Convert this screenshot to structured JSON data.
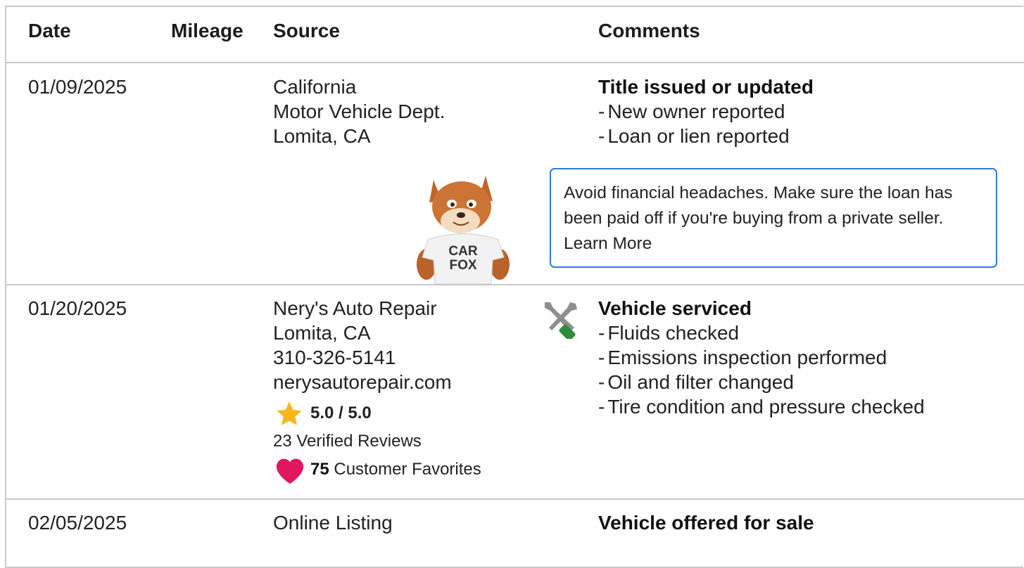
{
  "headers": {
    "date": "Date",
    "mileage": "Mileage",
    "source": "Source",
    "comments": "Comments"
  },
  "rows": [
    {
      "date": "01/09/2025",
      "source_lines": [
        "California",
        "Motor Vehicle Dept.",
        "Lomita, CA"
      ],
      "comment_title": "Title issued or updated",
      "comment_items": [
        "New owner reported",
        "Loan or lien reported"
      ],
      "callout": {
        "text": "Avoid financial headaches. Make sure the loan has been paid off if you're buying from a private seller.",
        "link": "Learn More"
      },
      "mascot_text": [
        "CAR",
        "FOX"
      ]
    },
    {
      "date": "01/20/2025",
      "source_lines": [
        "Nery's Auto Repair",
        "Lomita, CA",
        "310-326-5141",
        "nerysautorepair.com"
      ],
      "rating": "5.0 / 5.0",
      "reviews": "23 Verified Reviews",
      "favorites_count": "75",
      "favorites_label": "Customer Favorites",
      "service_icon": "wrench-screwdriver-icon",
      "comment_title": "Vehicle serviced",
      "comment_items": [
        "Fluids checked",
        "Emissions inspection performed",
        "Oil and filter changed",
        "Tire condition and pressure checked"
      ]
    },
    {
      "date": "02/05/2025",
      "source_lines": [
        "Online Listing"
      ],
      "comment_title": "Vehicle offered for sale"
    }
  ],
  "colors": {
    "callout_border": "#2e7bd8",
    "star": "#f6b71c",
    "heart": "#e0175f",
    "divider": "#c9c9c9"
  }
}
